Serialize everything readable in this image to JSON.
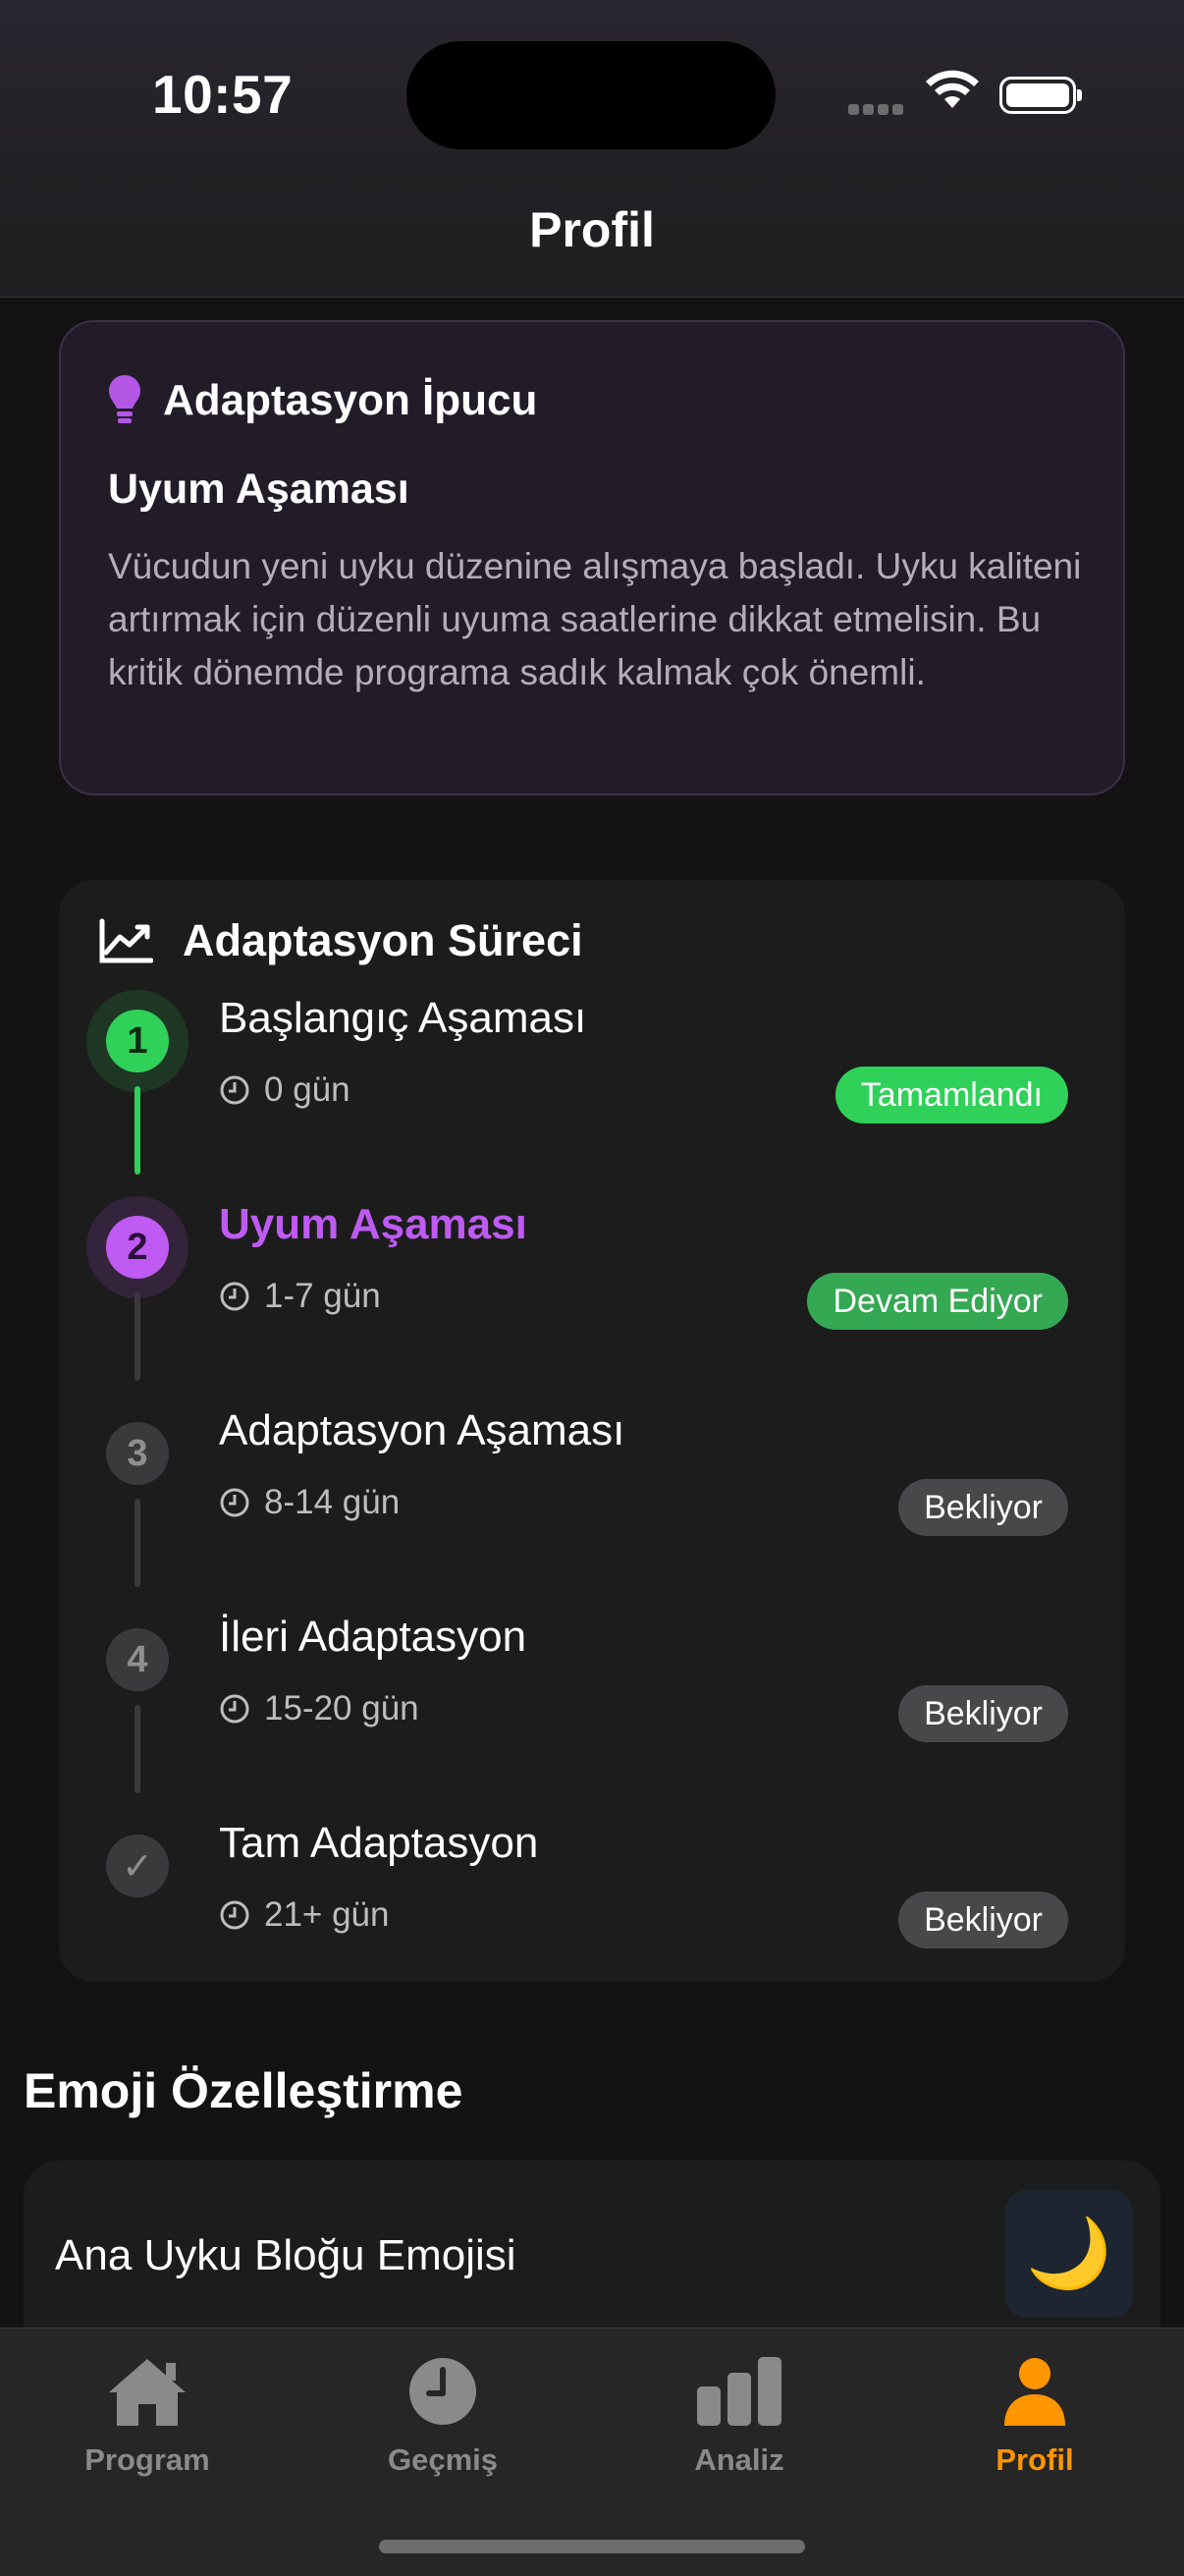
{
  "status_bar": {
    "time": "10:57"
  },
  "header": {
    "title": "Profil"
  },
  "tip_card": {
    "title": "Adaptasyon İpucu",
    "subtitle": "Uyum Aşaması",
    "text": "Vücudun yeni uyku düzenine alışmaya başladı. Uyku kaliteni artırmak için düzenli uyuma saatlerine dikkat etmelisin. Bu kritik dönemde programa sadık kalmak çok önemli.",
    "icon": "lightbulb-icon",
    "accent": "#b456e6"
  },
  "process": {
    "title": "Adaptasyon Süreci",
    "steps": [
      {
        "marker": "1",
        "title": "Başlangıç Aşaması",
        "days": "0 gün",
        "status": "Tamamlandı"
      },
      {
        "marker": "2",
        "title": "Uyum Aşaması",
        "days": "1-7 gün",
        "status": "Devam Ediyor"
      },
      {
        "marker": "3",
        "title": "Adaptasyon Aşaması",
        "days": "8-14 gün",
        "status": "Bekliyor"
      },
      {
        "marker": "4",
        "title": "İleri Adaptasyon",
        "days": "15-20 gün",
        "status": "Bekliyor"
      },
      {
        "marker": "✓",
        "title": "Tam Adaptasyon",
        "days": "21+ gün",
        "status": "Bekliyor"
      }
    ],
    "colors": {
      "completed": "#30d158",
      "active": "#bf5af2",
      "active_badge": "#34c759",
      "pending": "#3a3a3c"
    }
  },
  "emoji_section": {
    "title": "Emoji Özelleştirme",
    "row_label": "Ana Uyku Bloğu Emojisi",
    "emoji": "🌙"
  },
  "tab_bar": {
    "tabs": [
      {
        "label": "Program",
        "icon": "home-icon"
      },
      {
        "label": "Geçmiş",
        "icon": "clock-icon"
      },
      {
        "label": "Analiz",
        "icon": "chart-bars-icon"
      },
      {
        "label": "Profil",
        "icon": "person-icon",
        "active": true
      }
    ],
    "active_color": "#ff9500"
  }
}
